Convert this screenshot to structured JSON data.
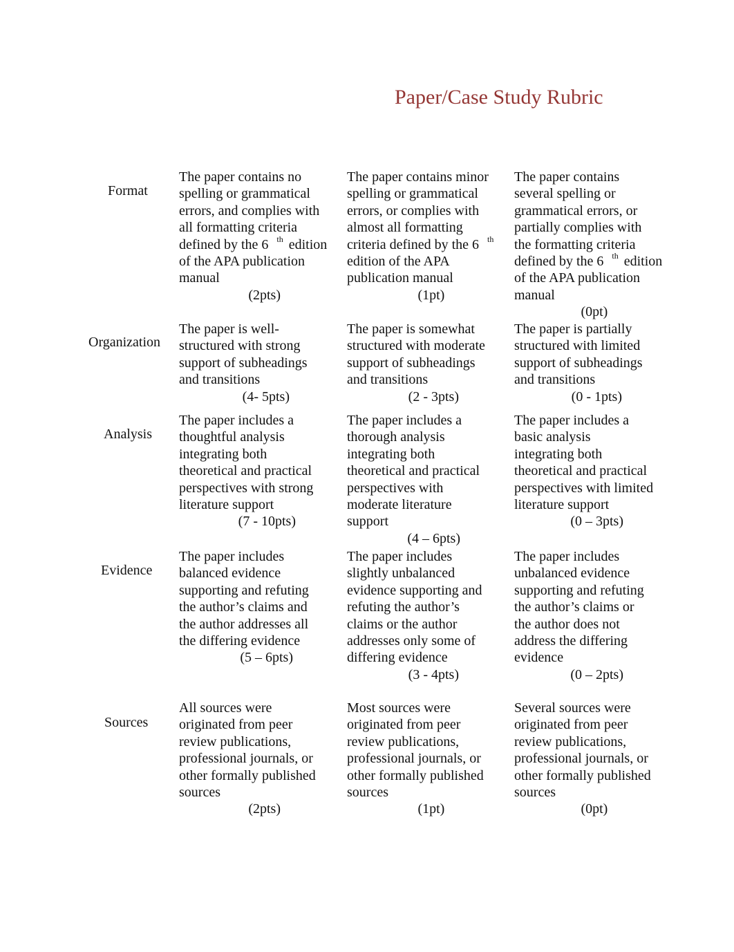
{
  "title": "Paper/Case Study Rubric",
  "rows": [
    {
      "criterion": "Format",
      "cells": [
        {
          "lines": [
            "The paper contains no",
            "spelling or grammatical",
            "errors, and complies with",
            "all formatting criteria",
            "defined by the 6|th| edition",
            "of the APA publication",
            "manual"
          ],
          "points": "(2pts)"
        },
        {
          "lines": [
            "The paper contains minor",
            "spelling or grammatical",
            "errors, or complies with",
            "almost all formatting",
            "criteria defined by the 6|th|",
            "edition of the APA",
            "publication manual"
          ],
          "points": "(1pt)"
        },
        {
          "lines": [
            "The paper contains",
            "several spelling or",
            "grammatical errors, or",
            "partially complies with",
            "the formatting criteria",
            "defined by the 6|th| edition",
            "of the APA publication",
            "manual"
          ],
          "points": "(0pt)"
        }
      ]
    },
    {
      "criterion": "Organization",
      "cells": [
        {
          "lines": [
            "The paper is well-",
            "structured with strong",
            "support of subheadings",
            "and transitions"
          ],
          "points": "(4- 5pts)"
        },
        {
          "lines": [
            "The paper is somewhat",
            "structured with moderate",
            "support of subheadings",
            "and transitions"
          ],
          "points": "(2 - 3pts)"
        },
        {
          "lines": [
            "The paper is partially",
            "structured with limited",
            "support of subheadings",
            "and transitions"
          ],
          "points": "(0 - 1pts)"
        }
      ]
    },
    {
      "criterion": "Analysis",
      "cells": [
        {
          "lines": [
            "The paper includes a",
            "thoughtful analysis",
            "integrating both",
            "theoretical and practical",
            "perspectives with strong",
            "literature support"
          ],
          "points": "(7 - 10pts)"
        },
        {
          "lines": [
            "The paper includes a",
            "thorough analysis",
            "integrating both",
            "theoretical and practical",
            "perspectives with",
            "moderate literature",
            "support"
          ],
          "points": "(4 – 6pts)"
        },
        {
          "lines": [
            "The paper includes a",
            "basic analysis",
            "integrating both",
            "theoretical and practical",
            "perspectives with limited",
            "literature support"
          ],
          "points": "(0 – 3pts)"
        }
      ]
    },
    {
      "criterion": "Evidence",
      "cells": [
        {
          "lines": [
            "The paper includes",
            "balanced evidence",
            "supporting and refuting",
            "the author’s claims and",
            "the author addresses all",
            "the differing evidence"
          ],
          "points": "(5 – 6pts)"
        },
        {
          "lines": [
            "The paper includes",
            "slightly unbalanced",
            "evidence supporting and",
            "refuting the author’s",
            "claims or the author",
            "addresses only some of",
            "differing evidence"
          ],
          "points": "(3 - 4pts)"
        },
        {
          "lines": [
            "The paper includes",
            "unbalanced evidence",
            "supporting and refuting",
            "the author’s claims or",
            "the author does not",
            "address the differing",
            "evidence"
          ],
          "points": "(0 – 2pts)"
        }
      ]
    },
    {
      "criterion": "Sources",
      "cells": [
        {
          "lines": [
            "All sources were",
            "originated from peer",
            "review publications,",
            "professional journals, or",
            "other formally published",
            "sources"
          ],
          "points": "(2pts)"
        },
        {
          "lines": [
            "Most sources were",
            "originated from peer",
            "review publications,",
            "professional journals, or",
            "other formally published",
            "sources"
          ],
          "points": "(1pt)"
        },
        {
          "lines": [
            "Several sources were",
            "originated from peer",
            "review publications,",
            "professional journals, or",
            "other formally published",
            "sources"
          ],
          "points": "(0pt)"
        }
      ]
    }
  ]
}
